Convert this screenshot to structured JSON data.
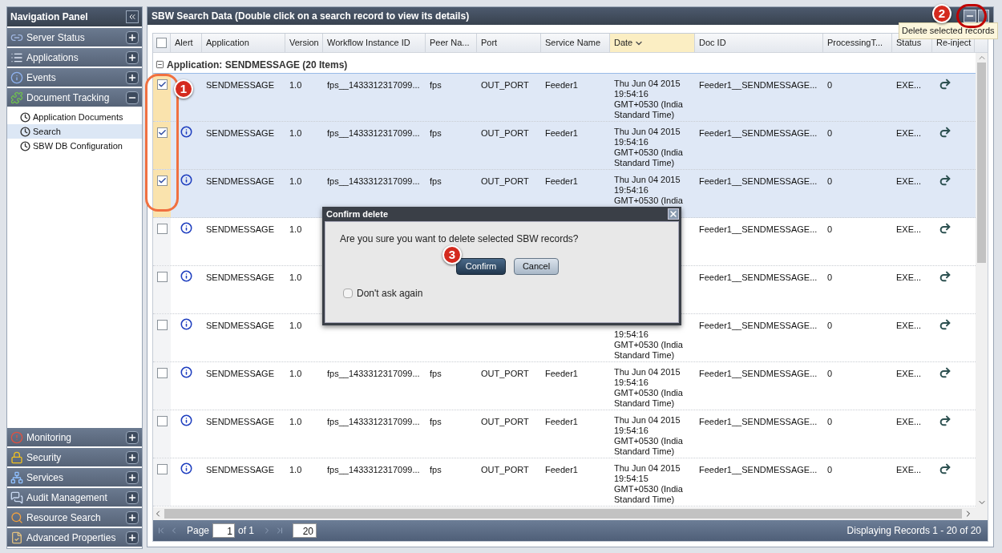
{
  "nav_panel": {
    "title": "Navigation Panel",
    "items": [
      {
        "label": "Server Status",
        "kind": "server",
        "expanded": false
      },
      {
        "label": "Applications",
        "kind": "apps",
        "expanded": false
      },
      {
        "label": "Events",
        "kind": "events",
        "expanded": false
      },
      {
        "label": "Document Tracking",
        "kind": "tracking",
        "expanded": true,
        "children": [
          {
            "label": "Application Documents",
            "selected": false
          },
          {
            "label": "Search",
            "selected": true
          },
          {
            "label": "SBW DB Configuration",
            "selected": false
          }
        ]
      }
    ],
    "bottom_items": [
      {
        "label": "Monitoring",
        "kind": "monitoring",
        "expanded": false
      },
      {
        "label": "Security",
        "kind": "security",
        "expanded": false
      },
      {
        "label": "Services",
        "kind": "services",
        "expanded": false
      },
      {
        "label": "Audit Management",
        "kind": "audit",
        "expanded": false
      },
      {
        "label": "Resource Search",
        "kind": "search",
        "expanded": false
      },
      {
        "label": "Advanced Properties",
        "kind": "advanced",
        "expanded": false
      }
    ]
  },
  "grid": {
    "title": "SBW Search Data (Double click on a search record to view its details)",
    "tooltip": "Delete selected records",
    "select_all_checked": false,
    "columns": [
      {
        "label": "Alert",
        "sorted": false
      },
      {
        "label": "Application",
        "sorted": false
      },
      {
        "label": "Version",
        "sorted": false
      },
      {
        "label": "Workflow Instance ID",
        "sorted": false
      },
      {
        "label": "Peer Na...",
        "sorted": false
      },
      {
        "label": "Port",
        "sorted": false
      },
      {
        "label": "Service Name",
        "sorted": false
      },
      {
        "label": "Date",
        "sorted": true
      },
      {
        "label": "Doc ID",
        "sorted": false
      },
      {
        "label": "ProcessingT...",
        "sorted": false
      },
      {
        "label": "Status",
        "sorted": false
      },
      {
        "label": "Re-inject",
        "sorted": false
      }
    ],
    "group": {
      "label": "Application: SENDMESSAGE (20 Items)",
      "expanded": true
    },
    "rows": [
      {
        "checked": true,
        "alert": false,
        "cells": [
          "",
          "SENDMESSAGE",
          "1.0",
          "fps__1433312317099...",
          "fps",
          "OUT_PORT",
          "Feeder1",
          [
            "Thu Jun 04 2015",
            "19:54:16",
            "GMT+0530 (India",
            "Standard Time)"
          ],
          "Feeder1__SENDMESSAGE...",
          "0",
          "EXE..."
        ]
      },
      {
        "checked": true,
        "alert": true,
        "cells": [
          "",
          "SENDMESSAGE",
          "1.0",
          "fps__1433312317099...",
          "fps",
          "OUT_PORT",
          "Feeder1",
          [
            "Thu Jun 04 2015",
            "19:54:16",
            "GMT+0530 (India",
            "Standard Time)"
          ],
          "Feeder1__SENDMESSAGE...",
          "0",
          "EXE..."
        ]
      },
      {
        "checked": true,
        "alert": true,
        "cells": [
          "",
          "SENDMESSAGE",
          "1.0",
          "fps__1433312317099...",
          "fps",
          "OUT_PORT",
          "Feeder1",
          [
            "Thu Jun 04 2015",
            "19:54:16",
            "GMT+0530 (India",
            null
          ],
          "Feeder1__SENDMESSAGE...",
          "0",
          "EXE..."
        ]
      },
      {
        "checked": false,
        "alert": true,
        "cells": [
          "",
          "SENDMESSAGE",
          "1.0",
          null,
          null,
          null,
          null,
          null,
          "Feeder1__SENDMESSAGE...",
          "0",
          "EXE..."
        ]
      },
      {
        "checked": false,
        "alert": true,
        "cells": [
          "",
          "SENDMESSAGE",
          "1.0",
          null,
          null,
          null,
          null,
          null,
          "Feeder1__SENDMESSAGE...",
          "0",
          "EXE..."
        ]
      },
      {
        "checked": false,
        "alert": true,
        "cells": [
          "",
          "SENDMESSAGE",
          "1.0",
          null,
          null,
          null,
          null,
          [
            null,
            "19:54:16",
            "GMT+0530 (India",
            "Standard Time)"
          ],
          "Feeder1__SENDMESSAGE...",
          "0",
          "EXE..."
        ]
      },
      {
        "checked": false,
        "alert": true,
        "cells": [
          "",
          "SENDMESSAGE",
          "1.0",
          "fps__1433312317099...",
          "fps",
          "OUT_PORT",
          "Feeder1",
          [
            "Thu Jun 04 2015",
            "19:54:16",
            "GMT+0530 (India",
            "Standard Time)"
          ],
          "Feeder1__SENDMESSAGE...",
          "0",
          "EXE..."
        ]
      },
      {
        "checked": false,
        "alert": true,
        "cells": [
          "",
          "SENDMESSAGE",
          "1.0",
          "fps__1433312317099...",
          "fps",
          "OUT_PORT",
          "Feeder1",
          [
            "Thu Jun 04 2015",
            "19:54:16",
            "GMT+0530 (India",
            "Standard Time)"
          ],
          "Feeder1__SENDMESSAGE...",
          "0",
          "EXE..."
        ]
      },
      {
        "checked": false,
        "alert": true,
        "cells": [
          "",
          "SENDMESSAGE",
          "1.0",
          "fps__1433312317099...",
          "fps",
          "OUT_PORT",
          "Feeder1",
          [
            "Thu Jun 04 2015",
            "19:54:15",
            "GMT+0530 (India",
            "Standard Time)"
          ],
          "Feeder1__SENDMESSAGE...",
          "0",
          "EXE..."
        ]
      }
    ],
    "pager": {
      "page_label": "Page",
      "page": "1",
      "of": "of 1",
      "page_size": "20",
      "summary": "Displaying Records 1 - 20 of 20"
    }
  },
  "dialog": {
    "title": "Confirm delete",
    "message": "Are you sure you want to delete selected SBW records?",
    "confirm": "Confirm",
    "cancel": "Cancel",
    "dont_ask": {
      "label": "Don't ask again",
      "checked": false
    }
  },
  "annotations": [
    {
      "label": "1"
    },
    {
      "label": "2"
    },
    {
      "label": "3"
    }
  ]
}
